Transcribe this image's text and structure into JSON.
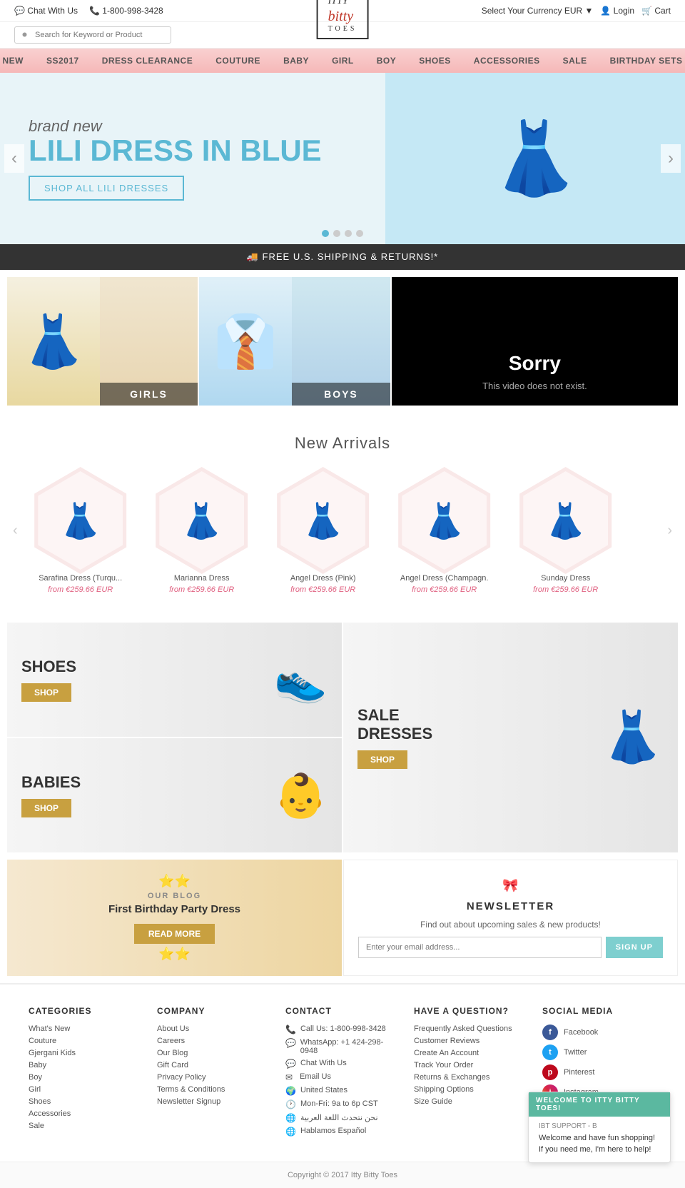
{
  "topbar": {
    "chat": "Chat With Us",
    "phone": "1-800-998-3428",
    "currency_label": "Select Your Currency",
    "currency": "EUR",
    "login": "Login",
    "cart": "Cart"
  },
  "logo": {
    "line1": "ITTY",
    "line2": "bitty",
    "line3": "TOES"
  },
  "search": {
    "placeholder": "Search for Keyword or Product"
  },
  "nav": {
    "items": [
      "NEW",
      "SS2017",
      "DRESS CLEARANCE",
      "COUTURE",
      "BABY",
      "GIRL",
      "BOY",
      "SHOES",
      "ACCESSORIES",
      "SALE",
      "BIRTHDAY SETS"
    ]
  },
  "hero": {
    "small_text": "brand new",
    "big_text": "LILI DRESS IN BLUE",
    "button": "SHOP ALL LILI DRESSES"
  },
  "shipping": {
    "text": "🚚 FREE U.S. SHIPPING & RETURNS!*"
  },
  "categories": {
    "girls_label": "GIRLS",
    "boys_label": "BOYS",
    "video_sorry": "Sorry",
    "video_desc": "This video does not exist."
  },
  "new_arrivals": {
    "title": "New Arrivals",
    "products": [
      {
        "name": "Sarafina Dress (Turqu...",
        "price": "from €259.66 EUR"
      },
      {
        "name": "Marianna Dress",
        "price": "from €259.66 EUR"
      },
      {
        "name": "Angel Dress (Pink)",
        "price": "from €259.66 EUR"
      },
      {
        "name": "Angel Dress (Champagn.",
        "price": "from €259.66 EUR"
      },
      {
        "name": "Sunday Dress",
        "price": "from €259.66 EUR"
      }
    ]
  },
  "promo": {
    "shoes_title": "SHOES",
    "shoes_btn": "SHOP",
    "babies_title": "BABIES",
    "babies_btn": "SHOP",
    "sale_title": "SALE",
    "sale_sub": "DRESSES",
    "sale_btn": "SHOP",
    "blog_label": "OUR BLOG",
    "blog_title": "First Birthday Party Dress",
    "blog_btn": "READ MORE",
    "newsletter_title": "NEWSLETTER",
    "newsletter_sub": "Find out about upcoming sales & new products!",
    "newsletter_placeholder": "Enter your email address...",
    "newsletter_btn": "SIGN UP"
  },
  "footer": {
    "categories_title": "CATEGORIES",
    "categories": [
      "What's New",
      "Couture",
      "Gjergani Kids",
      "Baby",
      "Boy",
      "Girl",
      "Shoes",
      "Accessories",
      "Sale"
    ],
    "company_title": "COMPANY",
    "company": [
      "About Us",
      "Careers",
      "Our Blog",
      "Gift Card",
      "Privacy Policy",
      "Terms & Conditions",
      "Newsletter Signup"
    ],
    "contact_title": "CONTACT",
    "contact": [
      {
        "icon": "📞",
        "text": "Call Us: 1-800-998-3428"
      },
      {
        "icon": "💬",
        "text": "WhatsApp: +1 424-298-0948"
      },
      {
        "icon": "💬",
        "text": "Chat With Us"
      },
      {
        "icon": "✉",
        "text": "Email Us"
      },
      {
        "icon": "🌍",
        "text": "United States"
      },
      {
        "icon": "🕐",
        "text": "Mon-Fri: 9a to 6p CST"
      },
      {
        "icon": "🌐",
        "text": "نحن نتحدث اللغة العربية"
      },
      {
        "icon": "🌐",
        "text": "Hablamos Español"
      }
    ],
    "question_title": "HAVE A QUESTION?",
    "question_links": [
      "Frequently Asked Questions",
      "Customer Reviews",
      "Create An Account",
      "Track Your Order",
      "Returns & Exchanges",
      "Shipping Options",
      "Size Guide"
    ],
    "social_title": "SOCIAL MEDIA",
    "social": [
      {
        "name": "Facebook",
        "class": "fb"
      },
      {
        "name": "Twitter",
        "class": "tw"
      },
      {
        "name": "Pinterest",
        "class": "pi"
      },
      {
        "name": "Instagram",
        "class": "ig"
      }
    ]
  },
  "copyright": "Copyright © 2017 Itty Bitty Toes",
  "chat_bubble": {
    "header": "WELCOME TO ITTY BITTY TOES!",
    "agent": "IBT SUPPORT - B",
    "message": "Welcome and have fun shopping! If you need me, I'm here to help!"
  }
}
